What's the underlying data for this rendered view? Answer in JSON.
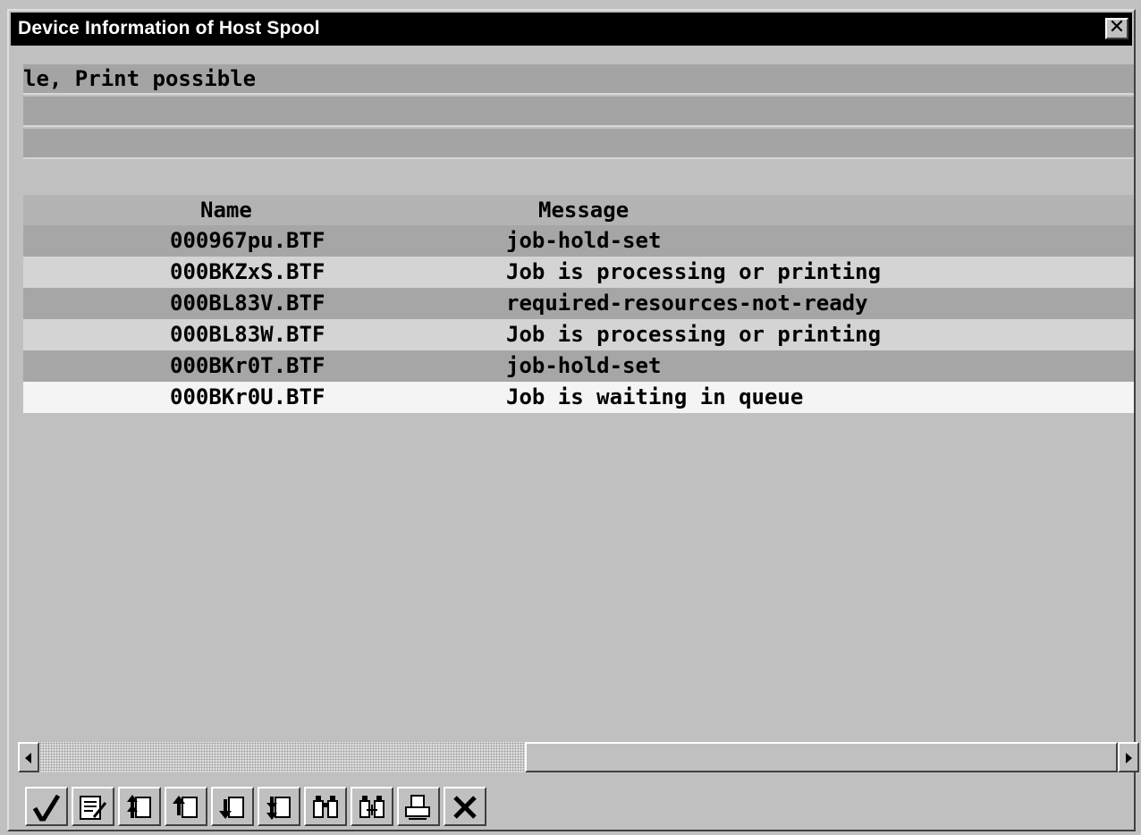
{
  "window": {
    "title": "Device Information of Host Spool",
    "close_glyph": "✕"
  },
  "info_lines": [
    "le, Print possible",
    "",
    ""
  ],
  "table": {
    "headers": {
      "name": "Name",
      "message": "Message"
    },
    "rows": [
      {
        "name": "000967pu.BTF",
        "message": "job-hold-set"
      },
      {
        "name": "000BKZxS.BTF",
        "message": "Job is processing or printing"
      },
      {
        "name": "000BL83V.BTF",
        "message": "required-resources-not-ready"
      },
      {
        "name": "000BL83W.BTF",
        "message": "Job is processing or printing"
      },
      {
        "name": "000BKr0T.BTF",
        "message": "job-hold-set"
      },
      {
        "name": "000BKr0U.BTF",
        "message": "Job is waiting in queue"
      }
    ]
  },
  "scrollbar": {
    "thumb_start_fraction": 0.45
  },
  "toolbar": {
    "icons": [
      "checkmark-icon",
      "edit-document-icon",
      "first-page-icon",
      "previous-page-icon",
      "next-page-icon",
      "last-page-icon",
      "find-icon",
      "find-next-icon",
      "print-icon",
      "close-x-icon"
    ]
  },
  "colors": {
    "titlebar": "#000000",
    "row_dark": "#a6a6a6",
    "row_light": "#d4d4d4",
    "row_selected": "#f4f4f4"
  }
}
